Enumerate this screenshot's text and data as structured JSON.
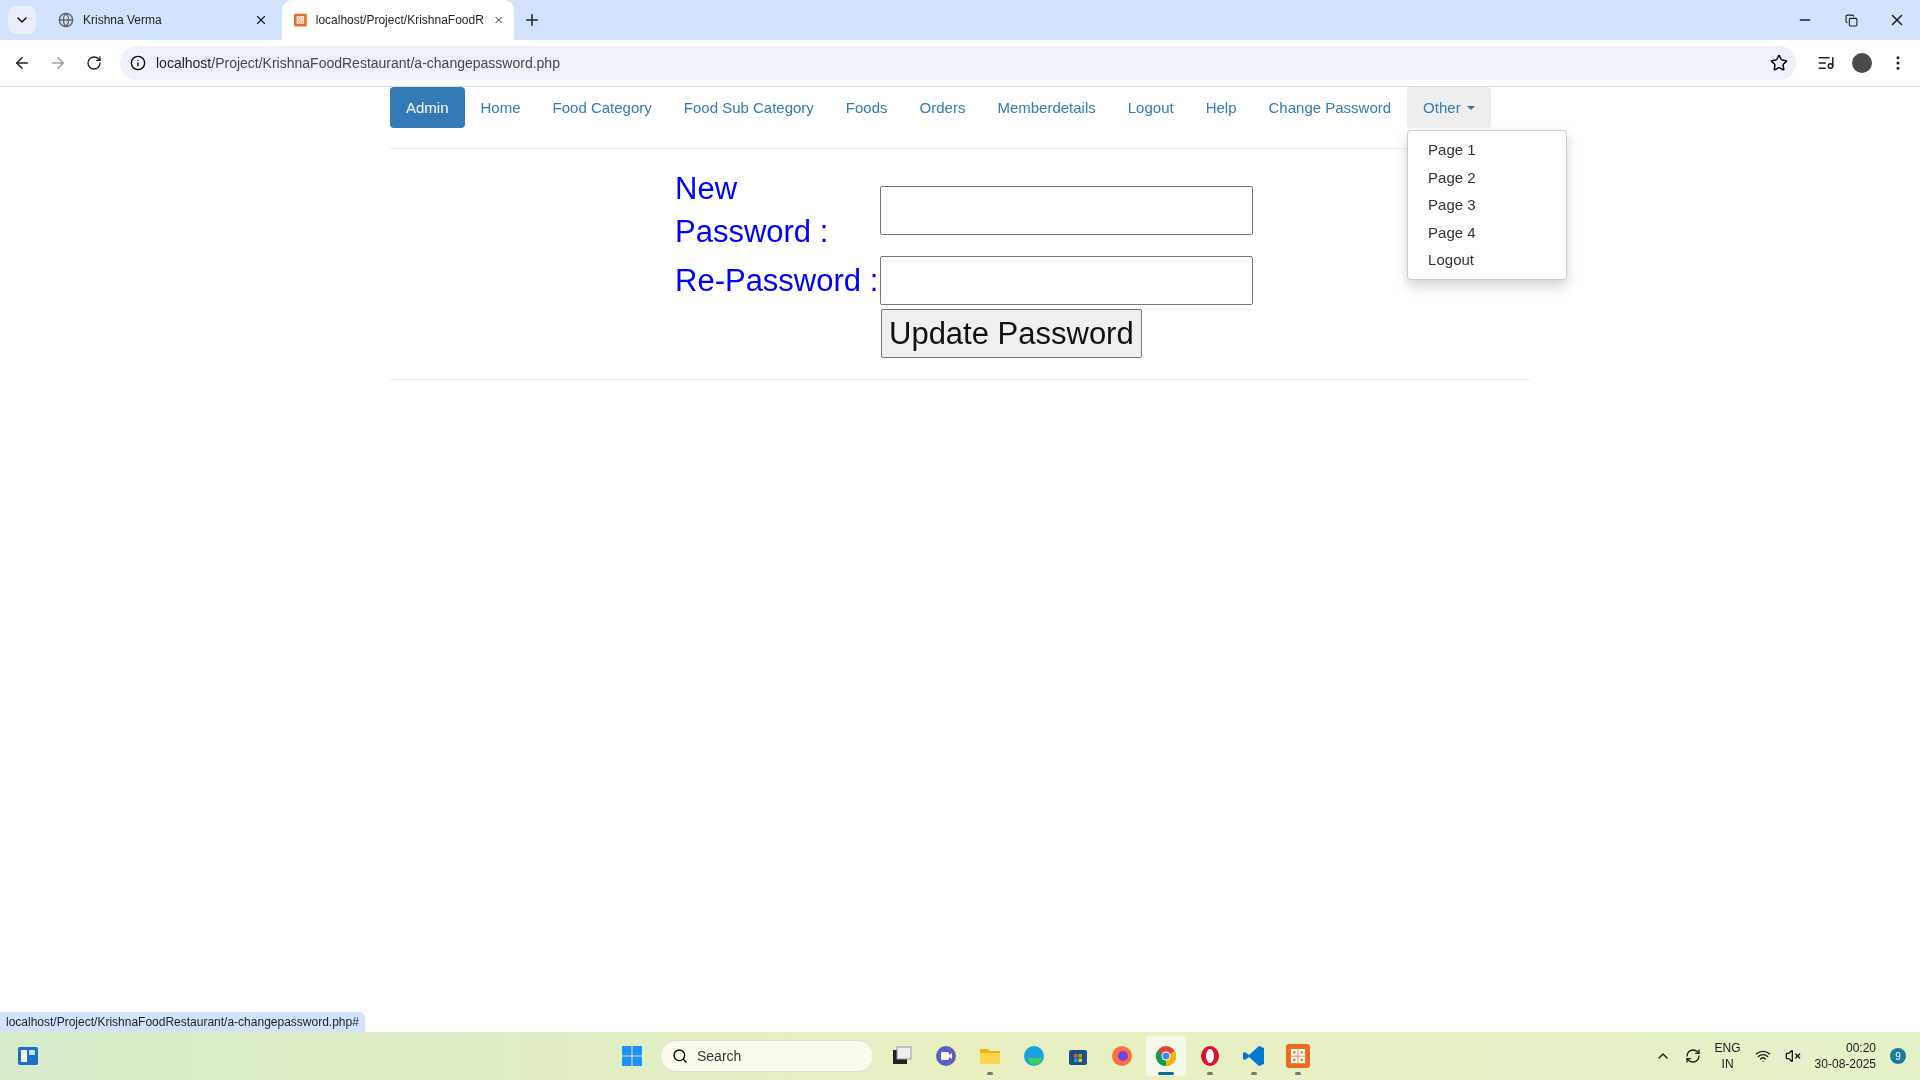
{
  "browser": {
    "tabs": [
      {
        "title": "Krishna Verma",
        "selected": false
      },
      {
        "title": "localhost/Project/KrishnaFoodR",
        "selected": true
      }
    ],
    "address": {
      "host": "localhost",
      "path": "/Project/KrishnaFoodRestaurant/a-changepassword.php"
    }
  },
  "navbar": {
    "items": [
      {
        "label": "Admin",
        "selected": true
      },
      {
        "label": "Home",
        "selected": false
      },
      {
        "label": "Food Category",
        "selected": false
      },
      {
        "label": "Food Sub Category",
        "selected": false
      },
      {
        "label": "Foods",
        "selected": false
      },
      {
        "label": "Orders",
        "selected": false
      },
      {
        "label": "Memberdetails",
        "selected": false
      },
      {
        "label": "Logout",
        "selected": false
      },
      {
        "label": "Help",
        "selected": false
      },
      {
        "label": "Change Password",
        "selected": false
      }
    ],
    "dropdown": {
      "label": "Other",
      "expanded": true,
      "items": [
        "Page 1",
        "Page 2",
        "Page 3",
        "Page 4",
        "Logout"
      ]
    }
  },
  "form": {
    "fields": [
      {
        "label": "New Password :"
      },
      {
        "label": "Re-Password :"
      }
    ],
    "submit": "Update Password"
  },
  "status_url": "localhost/Project/KrishnaFoodRestaurant/a-changepassword.php#",
  "taskbar": {
    "search": {
      "placeholder": "Search"
    },
    "apps": [
      {
        "kind": "taskview",
        "running": false,
        "selected": false
      },
      {
        "kind": "meet",
        "running": false,
        "selected": false
      },
      {
        "kind": "folder",
        "running": true,
        "selected": false
      },
      {
        "kind": "edge",
        "running": false,
        "selected": false
      },
      {
        "kind": "store",
        "running": false,
        "selected": false
      },
      {
        "kind": "firefox",
        "running": false,
        "selected": false
      },
      {
        "kind": "chrome",
        "running": true,
        "selected": true
      },
      {
        "kind": "opera",
        "running": true,
        "selected": false
      },
      {
        "kind": "vscode",
        "running": true,
        "selected": false
      },
      {
        "kind": "xampp",
        "running": true,
        "selected": false
      }
    ],
    "language": [
      "ENG",
      "IN"
    ],
    "time": "00:20",
    "date": "30-08-2025",
    "notifications": "9"
  }
}
